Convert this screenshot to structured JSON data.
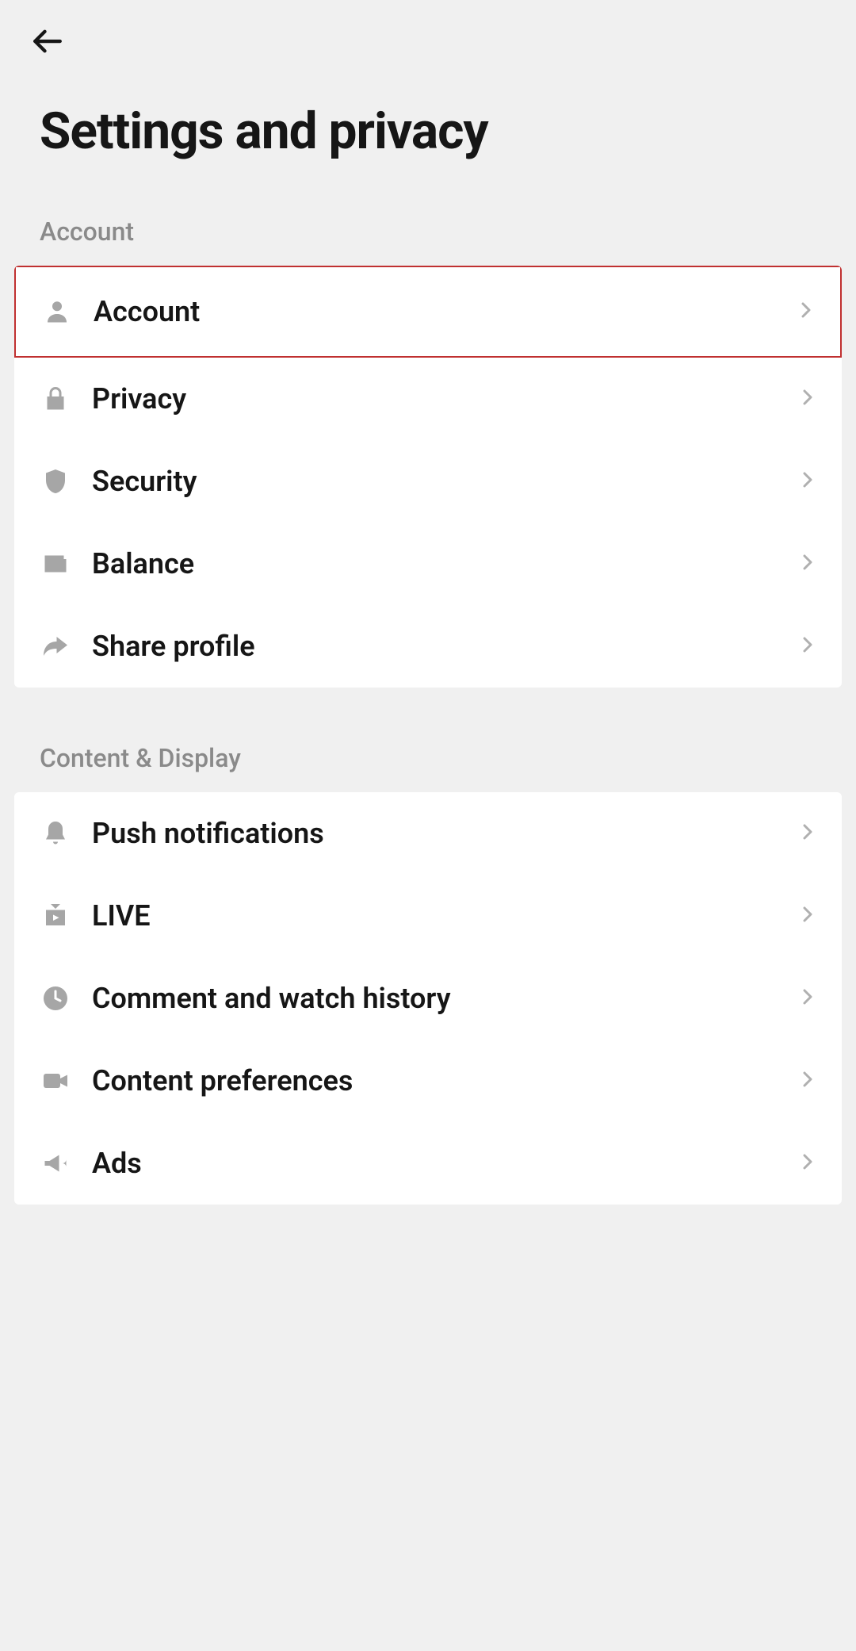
{
  "page_title": "Settings and privacy",
  "sections": [
    {
      "header": "Account",
      "items": [
        {
          "label": "Account",
          "icon": "person",
          "highlighted": true
        },
        {
          "label": "Privacy",
          "icon": "lock"
        },
        {
          "label": "Security",
          "icon": "shield"
        },
        {
          "label": "Balance",
          "icon": "wallet"
        },
        {
          "label": "Share profile",
          "icon": "share"
        }
      ]
    },
    {
      "header": "Content & Display",
      "items": [
        {
          "label": "Push notifications",
          "icon": "bell"
        },
        {
          "label": "LIVE",
          "icon": "tv"
        },
        {
          "label": "Comment and watch history",
          "icon": "clock"
        },
        {
          "label": "Content preferences",
          "icon": "video"
        },
        {
          "label": "Ads",
          "icon": "megaphone"
        }
      ]
    }
  ]
}
